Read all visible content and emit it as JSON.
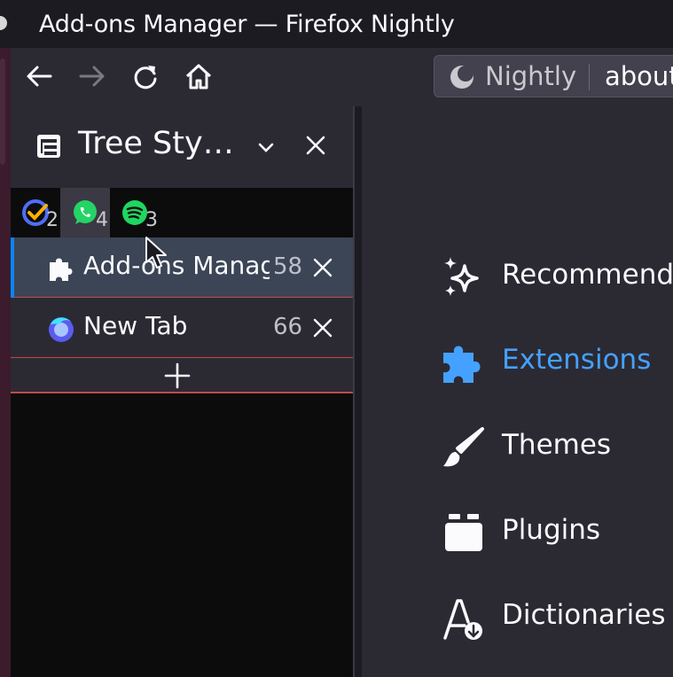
{
  "window": {
    "title": "Add-ons Manager — Firefox Nightly"
  },
  "urlbar": {
    "brand": "Nightly",
    "url": "about"
  },
  "sidebar": {
    "title": "Tree Sty…",
    "pinned_tabs": [
      {
        "icon": "ticktick-icon",
        "count": "2"
      },
      {
        "icon": "whatsapp-icon",
        "count": "4"
      },
      {
        "icon": "spotify-icon",
        "count": "3"
      }
    ],
    "tabs": [
      {
        "label": "Add-ons Manage",
        "count": "58",
        "selected": true
      },
      {
        "label": "New Tab",
        "count": "66",
        "selected": false
      }
    ]
  },
  "categories": [
    {
      "label": "Recommenda",
      "icon": "sparkle-icon"
    },
    {
      "label": "Extensions",
      "icon": "puzzle-icon",
      "active": true
    },
    {
      "label": "Themes",
      "icon": "brush-icon"
    },
    {
      "label": "Plugins",
      "icon": "plugin-icon"
    },
    {
      "label": "Dictionaries",
      "icon": "dictionary-icon"
    }
  ],
  "colors": {
    "accent": "#45a1ff",
    "selected_tab": "#3b4556",
    "background": "#2b2a33"
  }
}
